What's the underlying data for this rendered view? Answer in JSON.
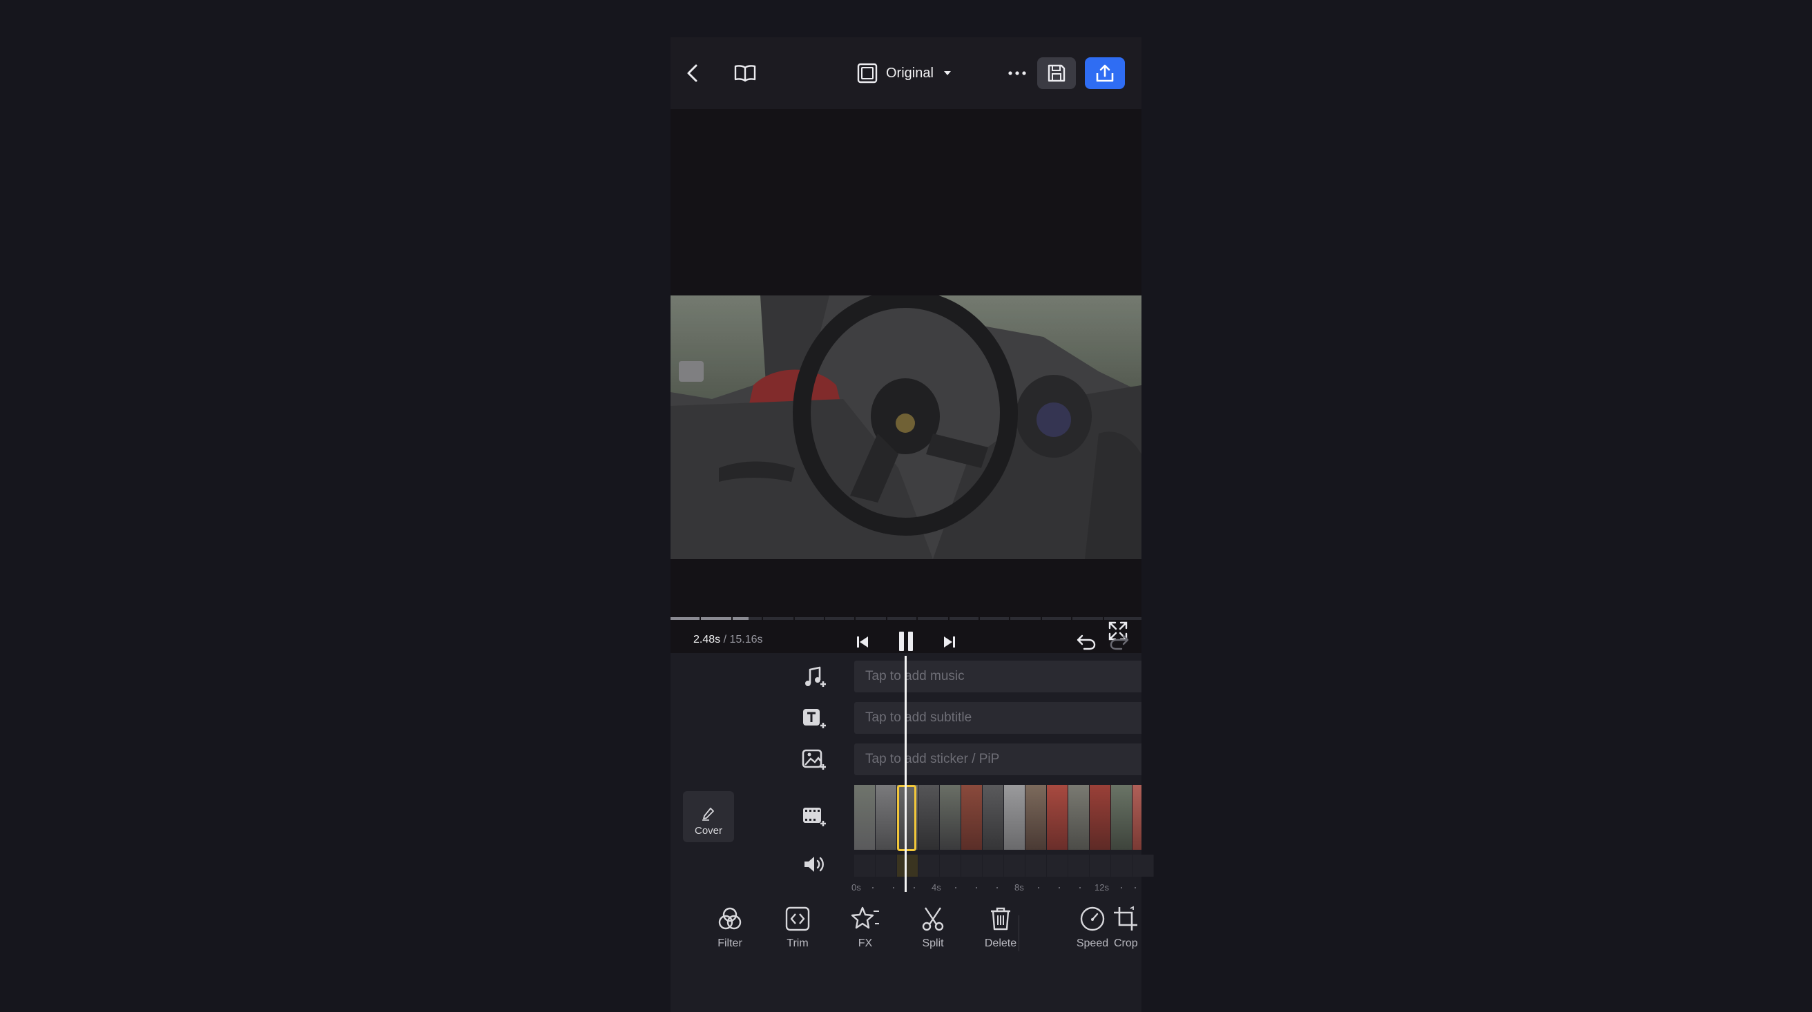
{
  "header": {
    "aspect_label": "Original",
    "icons": [
      "back-icon",
      "book-icon",
      "aspect-ratio-icon",
      "more-icon",
      "save-icon",
      "export-icon"
    ],
    "export_color": "#2f6df3"
  },
  "player": {
    "current_time": "2.48s",
    "separator": "/",
    "total_time": "15.16s",
    "progress_fraction": 0.164
  },
  "tracks": {
    "music_placeholder": "Tap to add music",
    "subtitle_placeholder": "Tap to add subtitle",
    "sticker_placeholder": "Tap to add sticker / PiP"
  },
  "cover": {
    "label": "Cover"
  },
  "ruler": {
    "labels": [
      "0s",
      "4s",
      "8s",
      "12s"
    ]
  },
  "toolbar": {
    "items": [
      {
        "label": "Filter",
        "icon": "filter-icon"
      },
      {
        "label": "Trim",
        "icon": "trim-icon"
      },
      {
        "label": "FX",
        "icon": "fx-icon"
      },
      {
        "label": "Split",
        "icon": "scissors-icon"
      },
      {
        "label": "Delete",
        "icon": "trash-icon"
      },
      {
        "label": "Speed",
        "icon": "speed-icon"
      },
      {
        "label": "Crop",
        "icon": "crop-icon"
      }
    ]
  },
  "colors": {
    "accent": "#2f6df3",
    "selection": "#f2c73a",
    "background": "#16161d"
  }
}
